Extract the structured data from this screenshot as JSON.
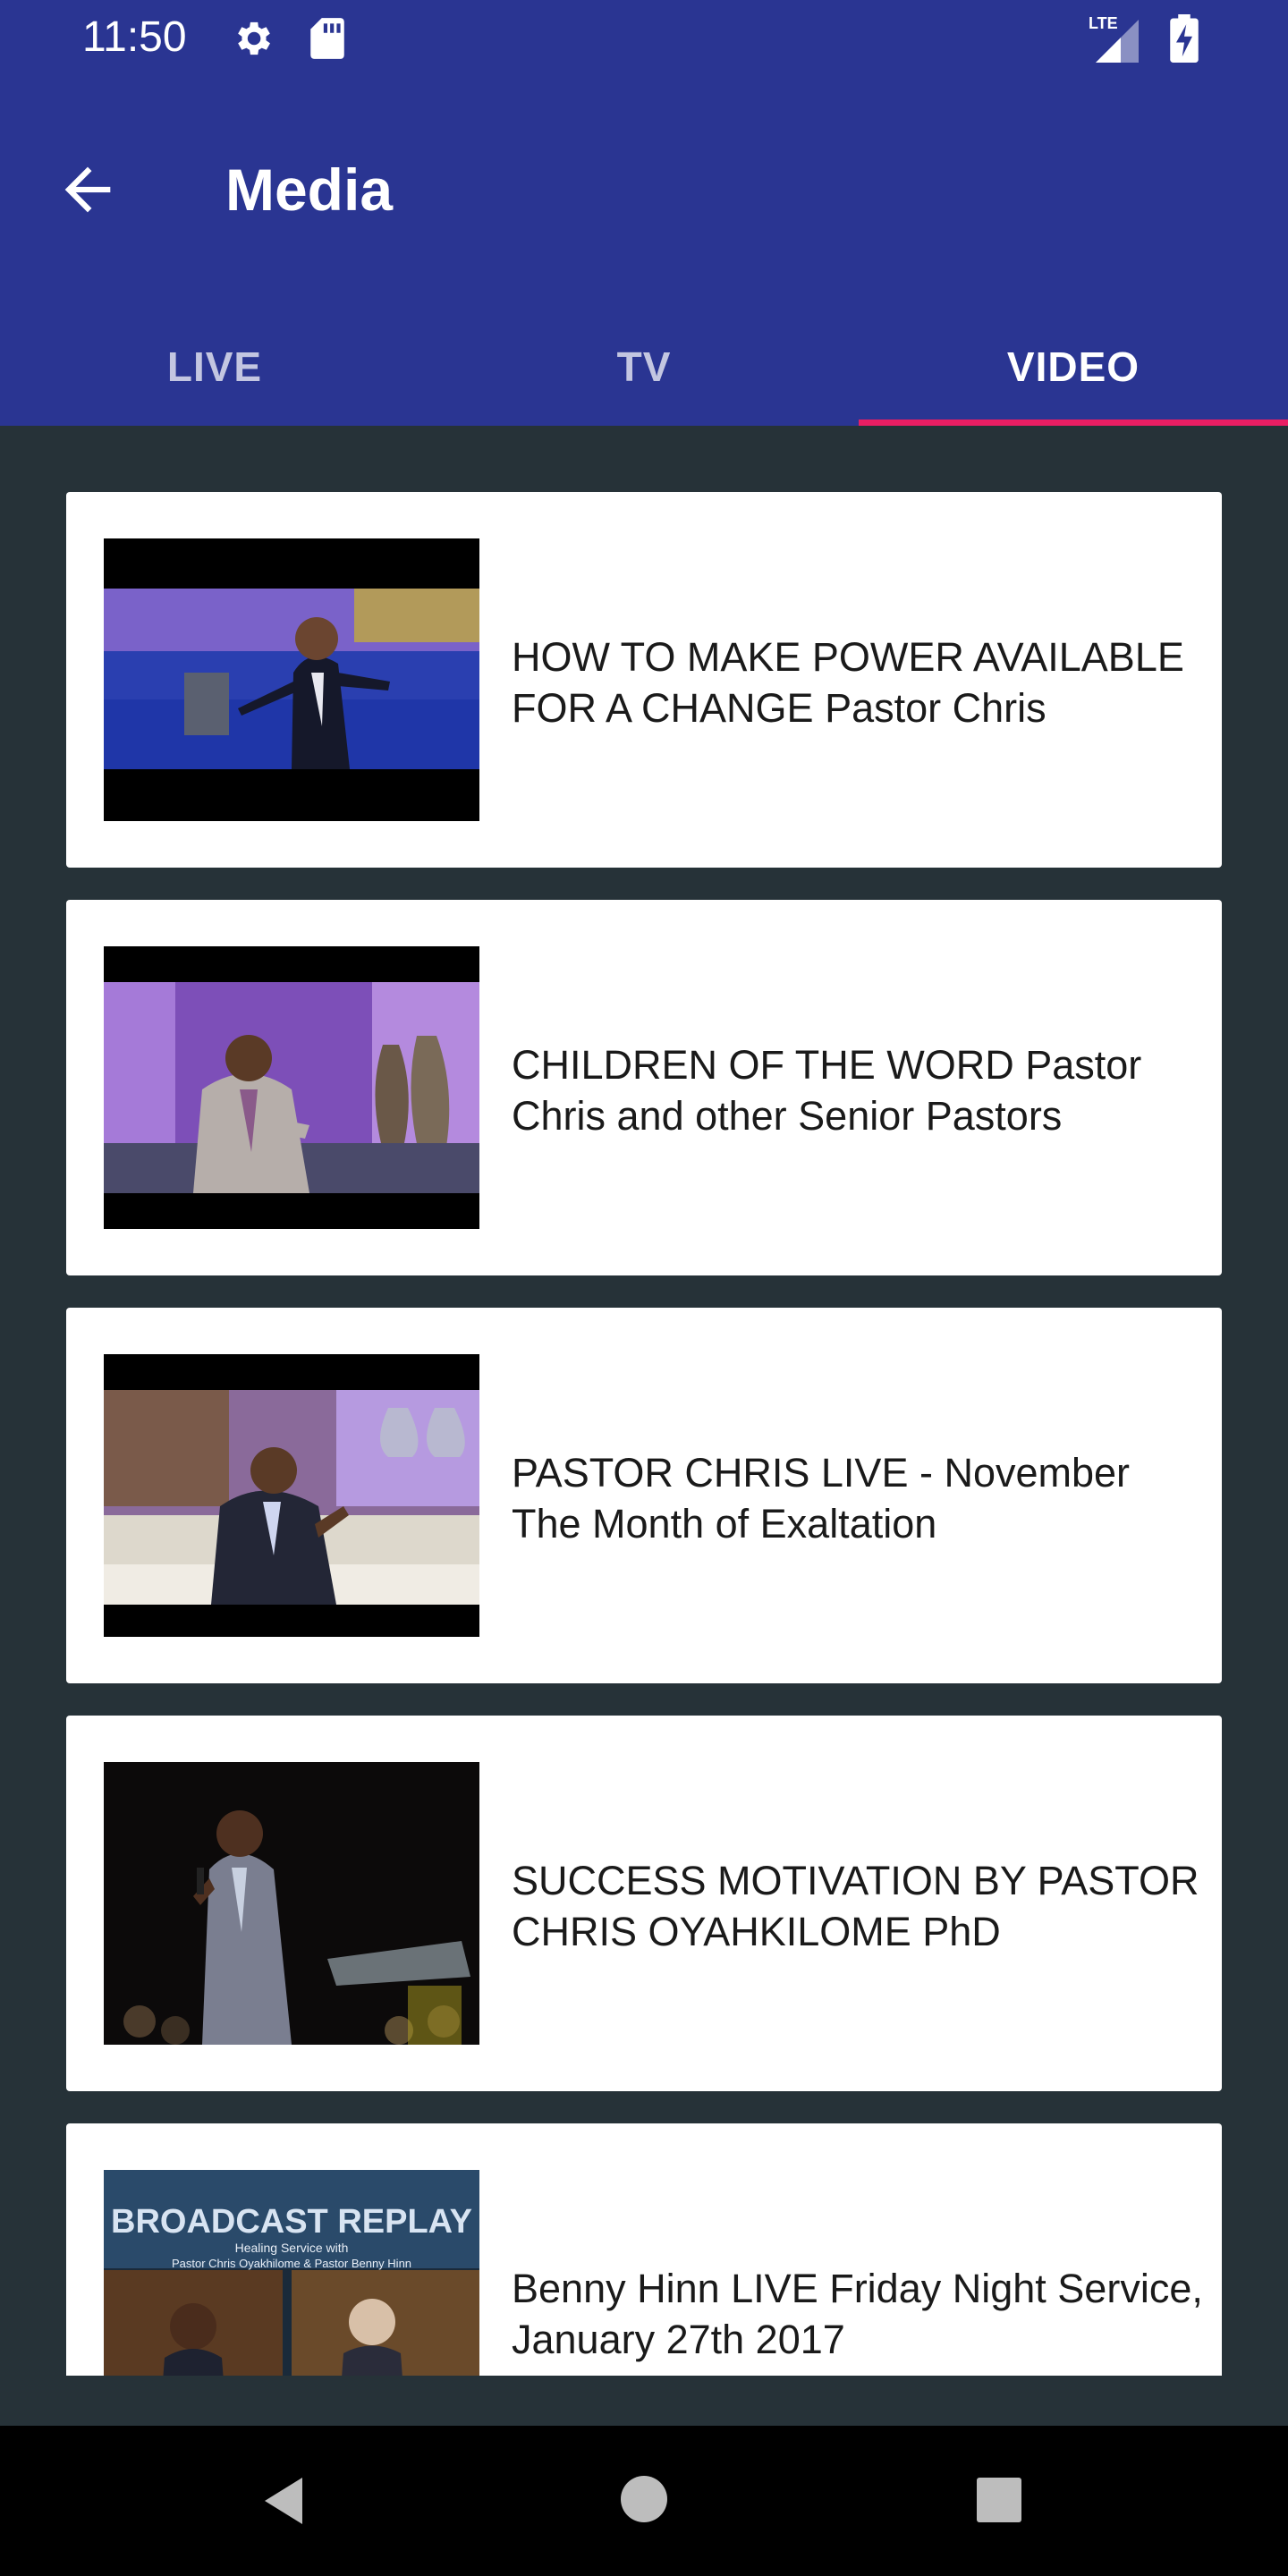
{
  "status": {
    "time": "11:50",
    "network": "LTE",
    "icons": [
      "gear-icon",
      "sd-card-icon",
      "signal-icon",
      "battery-charging-icon"
    ]
  },
  "appbar": {
    "title": "Media",
    "back_icon": "arrow-back-icon",
    "tabs": [
      {
        "label": "LIVE",
        "active": false
      },
      {
        "label": "TV",
        "active": false
      },
      {
        "label": "VIDEO",
        "active": true
      }
    ]
  },
  "videos": [
    {
      "title": "HOW TO MAKE POWER AVAILABLE FOR A CHANGE Pastor Chris"
    },
    {
      "title": "CHILDREN OF THE WORD Pastor Chris and other Senior Pastors"
    },
    {
      "title": "PASTOR CHRIS LIVE - November The Month of Exaltation"
    },
    {
      "title": "SUCCESS MOTIVATION BY PASTOR CHRIS OYAHKILOME PhD"
    },
    {
      "title": "Benny Hinn LIVE Friday Night Service, January 27th 2017",
      "thumb_text": "BROADCAST REPLAY",
      "thumb_subtext": "Healing Service with",
      "thumb_subtext2": "Pastor Chris Oyakhilome & Pastor Benny Hinn"
    }
  ],
  "colors": {
    "primary": "#2a3592",
    "accent": "#e91e63",
    "background": "#263238"
  }
}
